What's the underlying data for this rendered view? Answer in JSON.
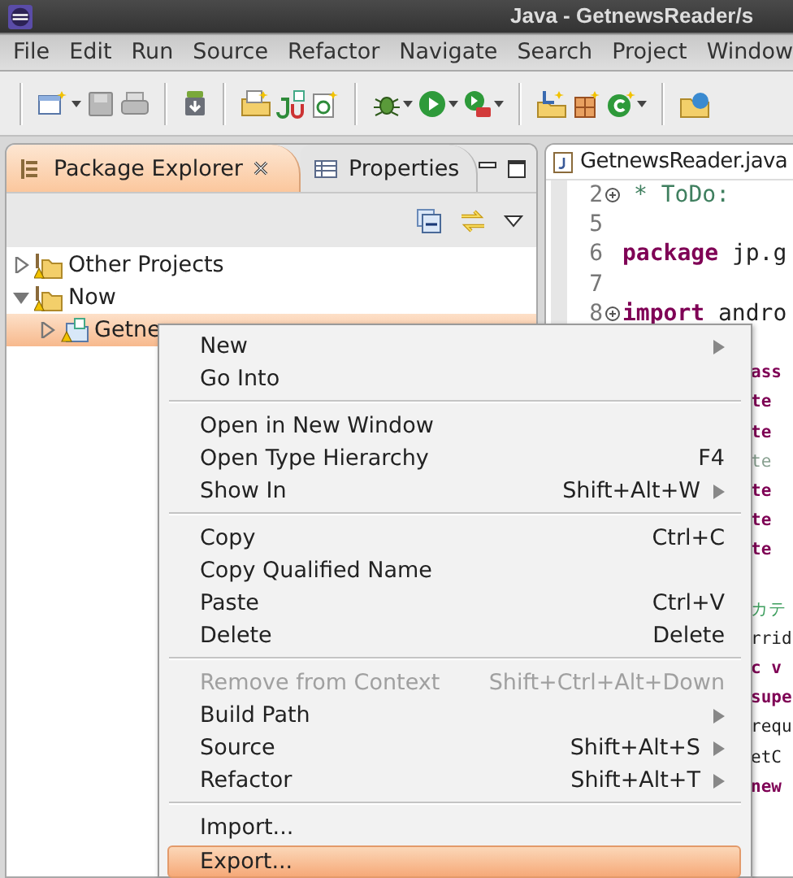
{
  "window": {
    "title": "Java - GetnewsReader/s"
  },
  "menu_bar": [
    {
      "label": "File"
    },
    {
      "label": "Edit"
    },
    {
      "label": "Run"
    },
    {
      "label": "Source"
    },
    {
      "label": "Refactor"
    },
    {
      "label": "Navigate"
    },
    {
      "label": "Search"
    },
    {
      "label": "Project"
    },
    {
      "label": "Window"
    }
  ],
  "package_explorer": {
    "tabs": [
      {
        "label": "Package Explorer",
        "selected": true,
        "closable": true
      },
      {
        "label": "Properties",
        "selected": false,
        "closable": false
      }
    ],
    "tree": [
      {
        "label": "Other Projects",
        "kind": "project",
        "expanded": false,
        "selected": false
      },
      {
        "label": "Now",
        "kind": "project",
        "expanded": true,
        "selected": false,
        "children": [
          {
            "label": "Getne",
            "kind": "android",
            "expanded": false,
            "selected": true
          }
        ]
      }
    ]
  },
  "editor": {
    "tab": {
      "label": "GetnewsReader.java"
    },
    "lines": [
      {
        "kind": "doc",
        "num": "2",
        "fold": true,
        "text": "* ToDo:"
      },
      {
        "kind": "empty",
        "num": "5",
        "fold": false
      },
      {
        "kind": "code",
        "num": "6",
        "fold": false,
        "text": "**package** jp.g"
      },
      {
        "kind": "empty",
        "num": "7",
        "fold": false
      },
      {
        "kind": "code",
        "num": "8",
        "fold": true,
        "text": "**import** andro"
      },
      {
        "kind": "blank"
      },
      {
        "kind": "keyword",
        "text": "ass"
      },
      {
        "kind": "keyword",
        "text": "te"
      },
      {
        "kind": "keyword",
        "text": "te"
      },
      {
        "kind": "faded",
        "text": "te"
      },
      {
        "kind": "keyword",
        "text": "te"
      },
      {
        "kind": "keyword",
        "text": "te"
      },
      {
        "kind": "keyword",
        "text": "te"
      },
      {
        "kind": "blank"
      },
      {
        "kind": "comment",
        "text": "カテ"
      },
      {
        "kind": "plain",
        "text": "rrid"
      },
      {
        "kind": "keyword",
        "text": "c v"
      },
      {
        "kind": "keyword",
        "text": "supe"
      },
      {
        "kind": "plain",
        "text": "requ"
      },
      {
        "kind": "plain",
        "text": "etC"
      },
      {
        "kind": "keyword",
        "text": "new"
      }
    ]
  },
  "context_menu": {
    "items": [
      {
        "kind": "item",
        "label": "New",
        "submenu": true,
        "disabled": false,
        "selected": false
      },
      {
        "kind": "item",
        "label": "Go Into",
        "submenu": false,
        "disabled": false,
        "selected": false
      },
      {
        "kind": "separator"
      },
      {
        "kind": "item",
        "label": "Open in New Window",
        "submenu": false,
        "disabled": false,
        "selected": false
      },
      {
        "kind": "item",
        "label": "Open Type Hierarchy",
        "shortcut": "F4",
        "submenu": false,
        "disabled": false,
        "selected": false
      },
      {
        "kind": "item",
        "label": "Show In",
        "shortcut": "Shift+Alt+W",
        "submenu": true,
        "disabled": false,
        "selected": false
      },
      {
        "kind": "separator"
      },
      {
        "kind": "item",
        "label": "Copy",
        "shortcut": "Ctrl+C",
        "submenu": false,
        "disabled": false,
        "selected": false
      },
      {
        "kind": "item",
        "label": "Copy Qualified Name",
        "submenu": false,
        "disabled": false,
        "selected": false
      },
      {
        "kind": "item",
        "label": "Paste",
        "shortcut": "Ctrl+V",
        "submenu": false,
        "disabled": false,
        "selected": false
      },
      {
        "kind": "item",
        "label": "Delete",
        "shortcut": "Delete",
        "submenu": false,
        "disabled": false,
        "selected": false
      },
      {
        "kind": "separator"
      },
      {
        "kind": "item",
        "label": "Remove from Context",
        "shortcut": "Shift+Ctrl+Alt+Down",
        "submenu": false,
        "disabled": true,
        "selected": false
      },
      {
        "kind": "item",
        "label": "Build Path",
        "submenu": true,
        "disabled": false,
        "selected": false
      },
      {
        "kind": "item",
        "label": "Source",
        "shortcut": "Shift+Alt+S",
        "submenu": true,
        "disabled": false,
        "selected": false
      },
      {
        "kind": "item",
        "label": "Refactor",
        "shortcut": "Shift+Alt+T",
        "submenu": true,
        "disabled": false,
        "selected": false
      },
      {
        "kind": "separator"
      },
      {
        "kind": "item",
        "label": "Import...",
        "submenu": false,
        "disabled": false,
        "selected": false
      },
      {
        "kind": "item",
        "label": "Export...",
        "submenu": false,
        "disabled": false,
        "selected": true
      }
    ]
  }
}
